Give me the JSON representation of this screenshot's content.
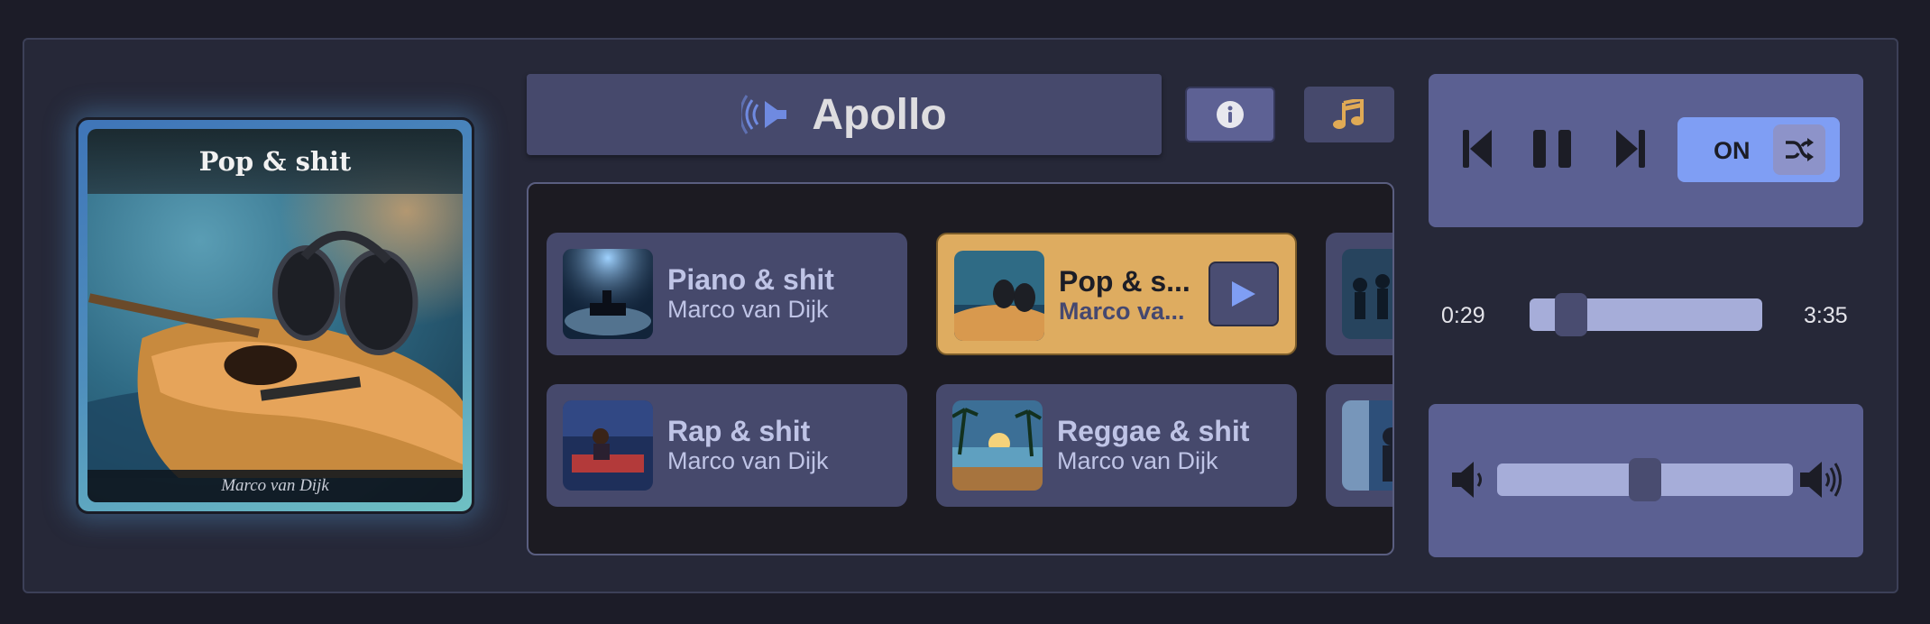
{
  "app": {
    "title": "Apollo",
    "icons": {
      "speaker": "speaker-waves-icon",
      "info": "info-circle-icon",
      "music": "music-note-icon"
    }
  },
  "now_playing": {
    "title": "Pop & shit",
    "artist": "Marco van Dijk"
  },
  "playlist": [
    {
      "title": "Piano & shit",
      "artist": "Marco van Dijk",
      "active": false
    },
    {
      "title": "Pop & s...",
      "artist": "Marco va...",
      "active": true
    },
    {
      "title": "Rap & shit",
      "artist": "Marco van Dijk",
      "active": false
    },
    {
      "title": "Reggae & shit",
      "artist": "Marco van Dijk",
      "active": false
    }
  ],
  "controls": {
    "shuffle_label": "ON",
    "shuffle_on": true,
    "icons": [
      "skip-previous-icon",
      "pause-icon",
      "skip-next-icon",
      "shuffle-icon"
    ]
  },
  "progress": {
    "current": "0:29",
    "duration": "3:35",
    "fraction": 0.13
  },
  "volume": {
    "fraction": 0.5,
    "icons": [
      "volume-low-icon",
      "volume-high-icon"
    ]
  },
  "colors": {
    "background": "#1c1c28",
    "panel": "#46496c",
    "accent_active": "#deac60",
    "shuffle_on": "#7f9ef4",
    "slider": "#a6add9"
  }
}
